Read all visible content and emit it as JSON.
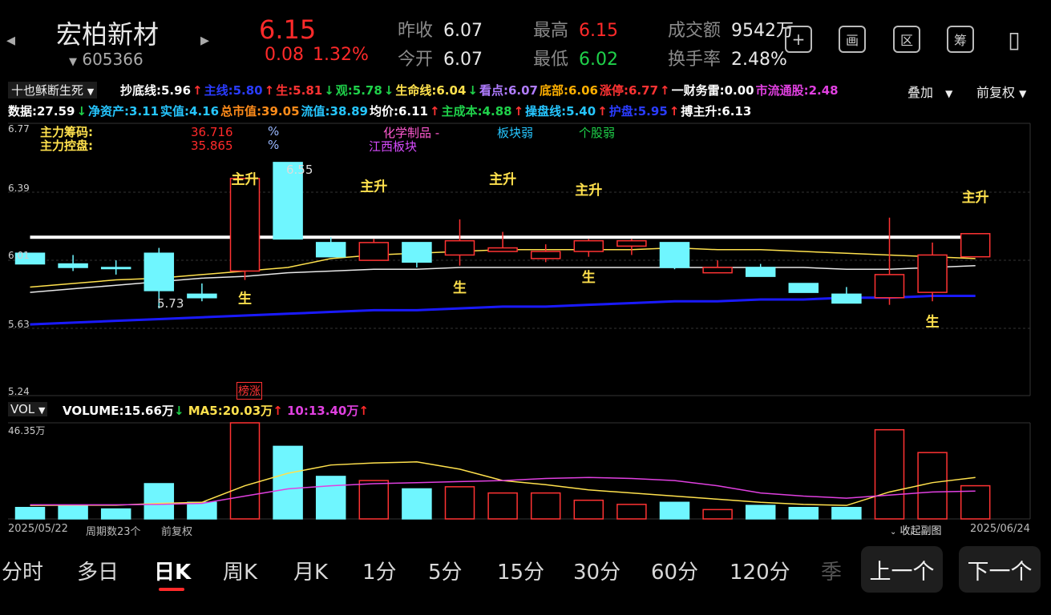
{
  "stock": {
    "name": "宏柏新材",
    "code": "605366",
    "price": "6.15",
    "change": "0.08",
    "change_pct": "1.32%"
  },
  "quote": {
    "prev_close_label": "昨收",
    "prev_close": "6.07",
    "open_label": "今开",
    "open": "6.07",
    "high_label": "最高",
    "high": "6.15",
    "low_label": "最低",
    "low": "6.02",
    "amount_label": "成交额",
    "amount": "9542万",
    "turnover_label": "换手率",
    "turnover": "2.48%"
  },
  "toolbar_icons": [
    "plus-icon",
    "layout-icon",
    "zone-icon",
    "chips-icon",
    "rotate-icon"
  ],
  "toolbar_glyphs": [
    "+",
    "画",
    "区",
    "筹",
    "▯"
  ],
  "indicator_name": "十也稣断生死",
  "overlay_label": "叠加",
  "adjust_label": "前复权",
  "indicator_row1": [
    {
      "t": "抄底线:",
      "v": "5.96",
      "a": "↑",
      "c": "#ffffff"
    },
    {
      "t": "主线:",
      "v": "5.80",
      "a": "↑",
      "c": "#2a3cff"
    },
    {
      "t": "生:",
      "v": "5.81",
      "a": "↓",
      "c": "#ff3333"
    },
    {
      "t": "观:",
      "v": "5.78",
      "a": "↓",
      "c": "#1fd14a"
    },
    {
      "t": "生命线:",
      "v": "6.04",
      "a": "↓",
      "c": "#ffe14d"
    },
    {
      "t": "看点:",
      "v": "6.07",
      "a": "",
      "c": "#b07cff"
    },
    {
      "t": "底部:",
      "v": "6.06",
      "a": "",
      "c": "#ffb000"
    },
    {
      "t": "涨停:",
      "v": "6.77",
      "a": "↑",
      "c": "#ff3333"
    },
    {
      "t": "一财务雷:",
      "v": "0.00",
      "a": "",
      "c": "#ffffff"
    },
    {
      "t": "市流通股:",
      "v": "2.48",
      "a": "",
      "c": "#e040e0"
    }
  ],
  "indicator_row2": [
    {
      "t": "数据:",
      "v": "27.59",
      "a": "↓",
      "c": "#ffffff"
    },
    {
      "t": "净资产:",
      "v": "3.11",
      "a": "",
      "c": "#26c6ff"
    },
    {
      "t": "实值:",
      "v": "4.16",
      "a": "",
      "c": "#26c6ff"
    },
    {
      "t": "总市值:",
      "v": "39.05",
      "a": "",
      "c": "#ff8c1a"
    },
    {
      "t": "流值:",
      "v": "38.89",
      "a": "",
      "c": "#26c6ff"
    },
    {
      "t": "均价:",
      "v": "6.11",
      "a": "↑",
      "c": "#ffffff"
    },
    {
      "t": "主成本:",
      "v": "4.88",
      "a": "↑",
      "c": "#1fd14a"
    },
    {
      "t": "操盘线:",
      "v": "5.40",
      "a": "↑",
      "c": "#26c6ff"
    },
    {
      "t": "护盘:",
      "v": "5.95",
      "a": "↑",
      "c": "#2a3cff"
    },
    {
      "t": "搏主升:",
      "v": "6.13",
      "a": "",
      "c": "#ffffff"
    }
  ],
  "annot": {
    "chips_label": "主力筹码:",
    "control_label": "主力控盘:",
    "chips_val": "36.716",
    "control_val": "35.865",
    "pct": "%",
    "pct2": "%",
    "industry": "化学制品 -",
    "region": "江西板块",
    "sector_weak": "板块弱",
    "stock_weak": "个股弱"
  },
  "vol": {
    "label": "VOL",
    "volume_label": "VOLUME:",
    "volume": "15.66万",
    "volume_arrow": "↓",
    "ma5_label": "MA5:",
    "ma5": "20.03万",
    "ma5_arrow": "↑",
    "ma10_label": "10:",
    "ma10": "13.40万",
    "ma10_arrow": "↑",
    "ymax_label": "46.35万"
  },
  "footer": {
    "start_date": "2025/05/22",
    "period_count": "周期数23个",
    "adjust": "前复权",
    "collapse": "收起副图",
    "end_date": "2025/06/24"
  },
  "tabs": [
    "分时",
    "多日",
    "日K",
    "周K",
    "月K",
    "1分",
    "5分",
    "15分",
    "30分",
    "60分",
    "120分",
    "季"
  ],
  "active_tab": "日K",
  "prev_button": "上一个",
  "next_button": "下一个",
  "chart_data": [
    {
      "type": "candlestick",
      "y_ticks": [
        "6.77",
        "6.39",
        "6.01",
        "5.63",
        "5.24"
      ],
      "ylim": [
        5.24,
        6.77
      ],
      "x_range": [
        "2025/05/22",
        "2025/06/24"
      ],
      "candles": [
        {
          "o": 5.98,
          "h": 6.04,
          "l": 5.98,
          "c": 6.04,
          "up": false
        },
        {
          "o": 5.98,
          "h": 6.03,
          "l": 5.94,
          "c": 5.96,
          "up": false
        },
        {
          "o": 5.96,
          "h": 6.0,
          "l": 5.92,
          "c": 5.96,
          "up": false
        },
        {
          "o": 6.04,
          "h": 6.07,
          "l": 5.73,
          "c": 5.83,
          "up": false
        },
        {
          "o": 5.81,
          "h": 5.87,
          "l": 5.77,
          "c": 5.79,
          "up": false
        },
        {
          "o": 5.94,
          "h": 6.46,
          "l": 5.89,
          "c": 6.46,
          "up": true
        },
        {
          "o": 6.55,
          "h": 6.55,
          "l": 6.12,
          "c": 6.12,
          "up": false
        },
        {
          "o": 6.1,
          "h": 6.13,
          "l": 6.04,
          "c": 6.02,
          "up": false
        },
        {
          "o": 6.1,
          "h": 6.12,
          "l": 6.05,
          "c": 6.0,
          "up": true
        },
        {
          "o": 6.1,
          "h": 6.1,
          "l": 5.96,
          "c": 5.99,
          "up": false
        },
        {
          "o": 6.03,
          "h": 6.23,
          "l": 5.97,
          "c": 6.11,
          "up": true
        },
        {
          "o": 6.07,
          "h": 6.16,
          "l": 6.06,
          "c": 6.05,
          "up": true
        },
        {
          "o": 6.05,
          "h": 6.09,
          "l": 5.99,
          "c": 6.01,
          "up": true
        },
        {
          "o": 6.05,
          "h": 6.12,
          "l": 6.02,
          "c": 6.11,
          "up": true
        },
        {
          "o": 6.08,
          "h": 6.12,
          "l": 6.03,
          "c": 6.11,
          "up": true
        },
        {
          "o": 6.1,
          "h": 6.09,
          "l": 5.95,
          "c": 5.96,
          "up": false
        },
        {
          "o": 5.93,
          "h": 6.0,
          "l": 5.93,
          "c": 5.96,
          "up": true
        },
        {
          "o": 5.96,
          "h": 5.98,
          "l": 5.91,
          "c": 5.91,
          "up": false
        },
        {
          "o": 5.87,
          "h": 5.87,
          "l": 5.82,
          "c": 5.82,
          "up": false
        },
        {
          "o": 5.81,
          "h": 5.85,
          "l": 5.76,
          "c": 5.76,
          "up": false
        },
        {
          "o": 5.92,
          "h": 6.24,
          "l": 5.75,
          "c": 5.79,
          "up": true
        },
        {
          "o": 5.82,
          "h": 6.1,
          "l": 5.77,
          "c": 6.03,
          "up": true
        },
        {
          "o": 6.02,
          "h": 6.15,
          "l": 6.02,
          "c": 6.15,
          "up": true
        }
      ],
      "series": [
        {
          "name": "搏主升",
          "color": "#ffffff",
          "values": [
            6.13,
            6.13,
            6.13,
            6.13,
            6.13,
            6.13,
            6.13,
            6.13,
            6.13,
            6.13,
            6.13,
            6.13,
            6.13,
            6.13,
            6.13,
            6.13,
            6.13,
            6.13,
            6.13,
            6.13,
            6.13,
            6.13,
            6.13
          ]
        },
        {
          "name": "生命线",
          "color": "#ffe14d",
          "values": [
            5.85,
            5.87,
            5.89,
            5.9,
            5.92,
            5.94,
            5.96,
            6.01,
            6.03,
            6.04,
            6.05,
            6.06,
            6.06,
            6.06,
            6.06,
            6.07,
            6.06,
            6.06,
            6.05,
            6.04,
            6.03,
            6.02,
            6.01
          ]
        },
        {
          "name": "抄底线",
          "color": "#e8e8e8",
          "values": [
            5.82,
            5.84,
            5.86,
            5.88,
            5.9,
            5.91,
            5.93,
            5.94,
            5.95,
            5.95,
            5.96,
            5.96,
            5.96,
            5.96,
            5.96,
            5.96,
            5.96,
            5.96,
            5.96,
            5.95,
            5.95,
            5.96,
            5.97
          ]
        },
        {
          "name": "主线",
          "color": "#1a1aff",
          "values": [
            5.64,
            5.65,
            5.66,
            5.67,
            5.68,
            5.69,
            5.7,
            5.71,
            5.72,
            5.72,
            5.73,
            5.74,
            5.74,
            5.75,
            5.76,
            5.77,
            5.77,
            5.78,
            5.78,
            5.79,
            5.79,
            5.8,
            5.8
          ]
        }
      ],
      "markers": [
        {
          "i": 5,
          "text": "主升",
          "y": 6.43
        },
        {
          "i": 8,
          "text": "主升",
          "y": 6.39
        },
        {
          "i": 11,
          "text": "主升",
          "y": 6.43
        },
        {
          "i": 13,
          "text": "主升",
          "y": 6.37
        },
        {
          "i": 22,
          "text": "主升",
          "y": 6.33
        },
        {
          "i": 5,
          "text": "生",
          "y": 5.76
        },
        {
          "i": 10,
          "text": "生",
          "y": 5.82
        },
        {
          "i": 13,
          "text": "生",
          "y": 5.88
        },
        {
          "i": 21,
          "text": "生",
          "y": 5.63
        }
      ],
      "high_label": "6.55",
      "low_label": "5.73",
      "limit_tag": "榜涨"
    },
    {
      "type": "bar",
      "ylim": [
        0,
        46.35
      ],
      "volumes": [
        5.5,
        6.5,
        4.8,
        17,
        8,
        46.35,
        35,
        20.5,
        18.5,
        14.5,
        15.5,
        12.5,
        12.5,
        9,
        7,
        8,
        4.5,
        6.5,
        5.5,
        5.5,
        43,
        32,
        16
      ],
      "up": [
        false,
        false,
        false,
        false,
        false,
        true,
        false,
        false,
        true,
        false,
        true,
        true,
        true,
        true,
        true,
        false,
        true,
        false,
        false,
        false,
        true,
        true,
        true
      ],
      "series": [
        {
          "name": "MA5",
          "color": "#ffe14d",
          "values": [
            6.5,
            6.6,
            6.6,
            7.5,
            8,
            16,
            22,
            26,
            27,
            27.5,
            24,
            18.5,
            16.5,
            14,
            12.5,
            11,
            9.5,
            8,
            7,
            6.5,
            13,
            17.5,
            20
          ]
        },
        {
          "name": "10",
          "color": "#e040e0",
          "values": [
            6.8,
            6.8,
            6.8,
            7,
            7.5,
            11,
            14.5,
            16,
            17,
            17.5,
            18,
            18.5,
            19.5,
            20,
            19.5,
            18.5,
            16,
            12.5,
            11,
            10,
            11.5,
            13,
            13.4
          ]
        }
      ]
    }
  ]
}
